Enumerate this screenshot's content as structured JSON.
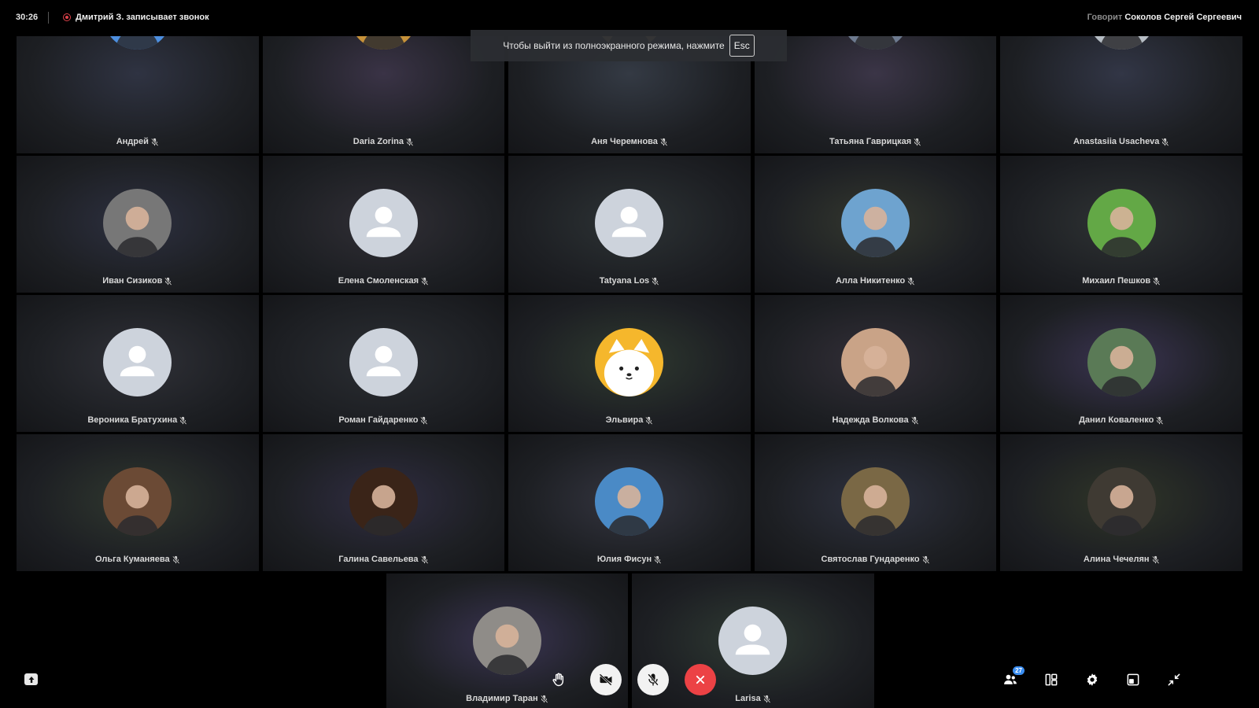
{
  "topbar": {
    "timer": "30:26",
    "recording_text": "Дмитрий З. записывает звонок",
    "speaking_label": "Говорит",
    "speaking_name": "Соколов Сергей Сергеевич"
  },
  "toast": {
    "text": "Чтобы выйти из полноэкранного режима, нажмите",
    "key": "Esc"
  },
  "participants": [
    {
      "name": "Андрей",
      "avatar": "photo",
      "muted": true
    },
    {
      "name": "Daria Zorina",
      "avatar": "photo",
      "muted": true
    },
    {
      "name": "Аня Черемнова",
      "avatar": "photo",
      "muted": true
    },
    {
      "name": "Татьяна Гаврицкая",
      "avatar": "photo",
      "muted": true
    },
    {
      "name": "Anastasiia Usacheva",
      "avatar": "photo",
      "muted": true
    },
    {
      "name": "Иван Сизиков",
      "avatar": "photo",
      "muted": true
    },
    {
      "name": "Елена Смоленская",
      "avatar": "default",
      "muted": true
    },
    {
      "name": "Tatyana Los",
      "avatar": "default",
      "muted": true
    },
    {
      "name": "Алла Никитенко",
      "avatar": "photo",
      "muted": true
    },
    {
      "name": "Михаил Пешков",
      "avatar": "photo",
      "muted": true
    },
    {
      "name": "Вероника Братухина",
      "avatar": "default",
      "muted": true
    },
    {
      "name": "Роман Гайдаренко",
      "avatar": "default",
      "muted": true
    },
    {
      "name": "Эльвира",
      "avatar": "cartoon",
      "muted": true
    },
    {
      "name": "Надежда Волкова",
      "avatar": "photo",
      "muted": true
    },
    {
      "name": "Данил Коваленко",
      "avatar": "photo",
      "muted": true
    },
    {
      "name": "Ольга Куманяева",
      "avatar": "photo",
      "muted": true
    },
    {
      "name": "Галина Савельева",
      "avatar": "photo",
      "muted": true
    },
    {
      "name": "Юлия Фисун",
      "avatar": "photo",
      "muted": true
    },
    {
      "name": "Святослав Гундаренко",
      "avatar": "photo",
      "muted": true
    },
    {
      "name": "Алина Чечелян",
      "avatar": "photo",
      "muted": true
    },
    {
      "name": "Владимир Таран",
      "avatar": "photo",
      "muted": true
    },
    {
      "name": "Larisa",
      "avatar": "default",
      "muted": true
    }
  ],
  "controls": {
    "participants_count": "27",
    "icons": [
      "share-screen-icon",
      "raise-hand-icon",
      "camera-off-icon",
      "mic-off-icon",
      "end-call-icon",
      "participants-icon",
      "layout-icon",
      "settings-icon",
      "picture-in-picture-icon",
      "exit-fullscreen-icon"
    ]
  },
  "colors": {
    "end_call": "#ec4245",
    "recording": "#e0424b",
    "badge": "#3a8ef2",
    "default_avatar": "#cdd3dc"
  }
}
